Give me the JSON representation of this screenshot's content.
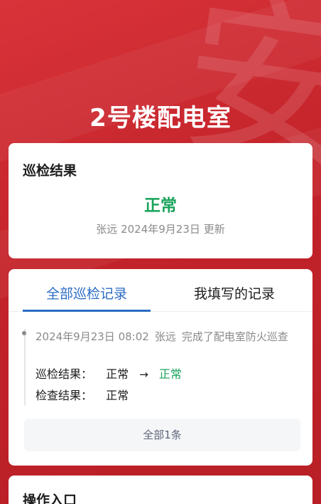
{
  "page": {
    "title": "2号楼配电室",
    "watermark": "安"
  },
  "result_card": {
    "title": "巡检结果",
    "status": "正常",
    "updater": "张远",
    "date": "2024年9月23日",
    "update_suffix": "更新"
  },
  "records": {
    "tabs": [
      {
        "label": "全部巡检记录",
        "active": true
      },
      {
        "label": "我填写的记录",
        "active": false
      }
    ],
    "entry": {
      "datetime": "2024年9月23日 08:02",
      "person": "张远",
      "action": "完成了配电室防火巡查",
      "inspect_label": "巡检结果：",
      "inspect_from": "正常",
      "inspect_arrow": "→",
      "inspect_to": "正常",
      "check_label": "检查结果：",
      "check_value": "正常"
    },
    "all_button": "全部1条"
  },
  "ops": {
    "title": "操作入口"
  },
  "colors": {
    "accent": "#2b6cc4",
    "success": "#19a35b",
    "brand_red": "#c9252b"
  }
}
